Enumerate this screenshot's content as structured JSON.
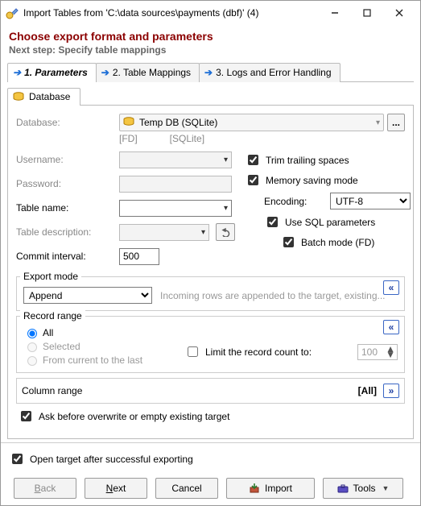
{
  "window": {
    "title": "Import Tables from 'C:\\data sources\\payments (dbf)' (4)"
  },
  "header": {
    "heading": "Choose export format and parameters",
    "subheading": "Next step: Specify table mappings"
  },
  "tabs": {
    "main": [
      {
        "label": "1. Parameters",
        "active": true
      },
      {
        "label": "2. Table Mappings",
        "active": false
      },
      {
        "label": "3. Logs and Error Handling",
        "active": false
      }
    ],
    "sub": {
      "label": "Database"
    }
  },
  "db": {
    "label": "Database:",
    "value": "Temp DB (SQLite)",
    "hint_left": "[FD]",
    "hint_right": "[SQLite]",
    "browse": "..."
  },
  "fields": {
    "username_label": "Username:",
    "password_label": "Password:",
    "table_name_label": "Table name:",
    "table_desc_label": "Table description:",
    "commit_label": "Commit interval:",
    "commit_value": "500"
  },
  "opts": {
    "trim": "Trim trailing spaces",
    "memsave": "Memory saving mode",
    "encoding_label": "Encoding:",
    "encoding_value": "UTF-8",
    "sqlparams": "Use SQL parameters",
    "batch": "Batch mode (FD)"
  },
  "export_mode": {
    "title": "Export mode",
    "value": "Append",
    "hint": "Incoming rows are appended to the target, existing..."
  },
  "record_range": {
    "title": "Record range",
    "all": "All",
    "selected": "Selected",
    "from_current": "From current to the last",
    "limit_label": "Limit the record count to:",
    "limit_value": "100"
  },
  "column_range": {
    "title": "Column range",
    "value": "[All]"
  },
  "confirm": {
    "ask_overwrite": "Ask before overwrite or empty existing target",
    "open_after": "Open target after successful exporting"
  },
  "buttons": {
    "back": "Back",
    "next": "Next",
    "cancel": "Cancel",
    "import": "Import",
    "tools": "Tools"
  }
}
